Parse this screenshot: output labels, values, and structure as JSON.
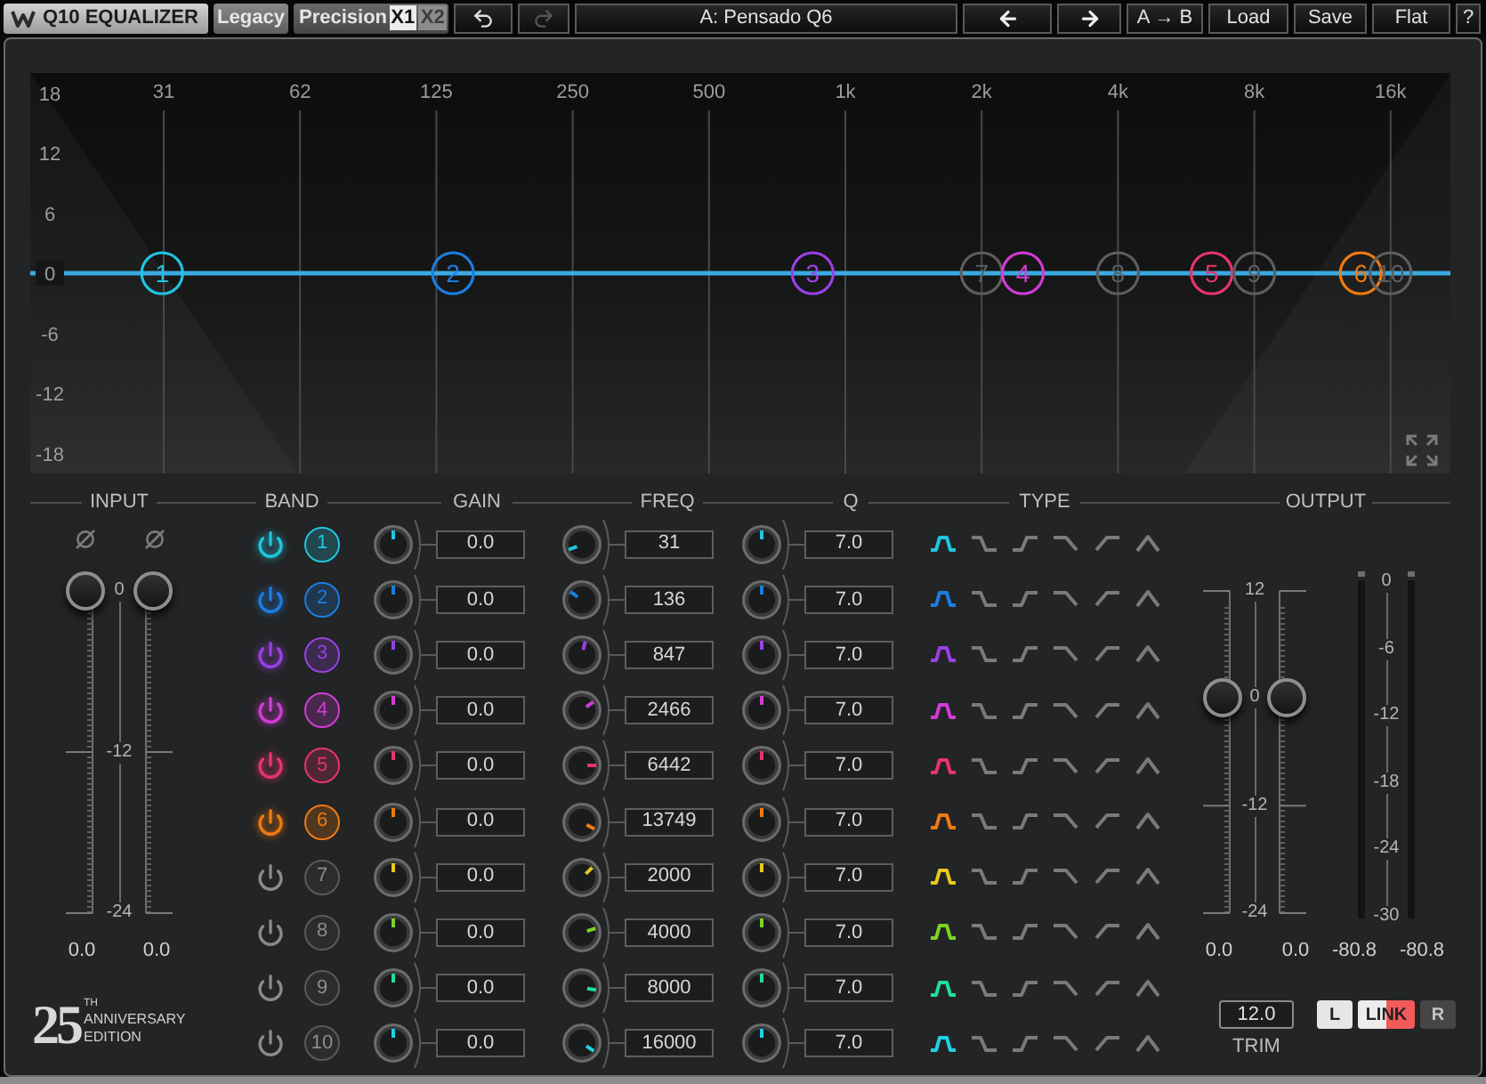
{
  "toolbar": {
    "logo": "Q10 EQUALIZER",
    "legacy": "Legacy",
    "precision": {
      "label": "Precision",
      "options": [
        {
          "label": "X1",
          "selected": true
        },
        {
          "label": "X2",
          "selected": false
        }
      ]
    },
    "history": [
      {
        "kind": "undo",
        "disabled": false
      },
      {
        "kind": "redo",
        "disabled": true
      }
    ],
    "preset": "A: Pensado Q6",
    "preset_nav": [
      {
        "kind": "prev"
      },
      {
        "kind": "next"
      }
    ],
    "buttons": [
      "A → B",
      "Load",
      "Save",
      "Flat",
      "?"
    ]
  },
  "graph": {
    "chart_data": {
      "type": "line",
      "categories": [
        null,
        "31",
        "62",
        "125",
        "250",
        "500",
        "1k",
        "2k",
        "4k",
        "8k",
        "16k"
      ],
      "values": [
        0,
        0,
        0,
        0,
        0,
        0,
        0,
        0,
        0,
        0,
        0
      ],
      "ylim": [
        -20,
        20
      ],
      "yticks": [
        18,
        12,
        6,
        0,
        -6,
        -12,
        -18
      ],
      "grid": true
    },
    "nodes": [
      "1",
      "2",
      "3",
      "7",
      "4",
      "8",
      "5",
      "9",
      "6",
      "10"
    ]
  },
  "input": {
    "title": "INPUT",
    "faders": [
      {
        "level": 1,
        "value": "0.0"
      },
      {
        "level": 1,
        "value": "0.0"
      }
    ],
    "scale": [
      "0",
      "-12",
      "-24"
    ]
  },
  "edition_badge": {
    "number": "25",
    "suffix": "TH",
    "lines": [
      "ANNIVERSARY",
      "EDITION"
    ]
  },
  "bands": {
    "columns": [
      "BAND",
      "GAIN",
      "FREQ",
      "Q",
      "TYPE"
    ],
    "rows": [
      {
        "number": "1",
        "on": true,
        "color": "#1ec6e0",
        "gain": "0.0",
        "freq": "31",
        "q": "7.0",
        "types": [
          {
            "kind": "bell",
            "selected": true
          },
          {
            "kind": "lowshelf",
            "selected": false
          },
          {
            "kind": "highshelf",
            "selected": false
          },
          {
            "kind": "highcut",
            "selected": false
          },
          {
            "kind": "lowcut",
            "selected": false
          },
          {
            "kind": "peak",
            "selected": false
          }
        ]
      },
      {
        "number": "2",
        "on": true,
        "color": "#1c7de2",
        "gain": "0.0",
        "freq": "136",
        "q": "7.0",
        "types": [
          {
            "kind": "bell",
            "selected": true
          },
          {
            "kind": "lowshelf",
            "selected": false
          },
          {
            "kind": "highshelf",
            "selected": false
          },
          {
            "kind": "highcut",
            "selected": false
          },
          {
            "kind": "lowcut",
            "selected": false
          },
          {
            "kind": "peak",
            "selected": false
          }
        ]
      },
      {
        "number": "3",
        "on": true,
        "color": "#9a40e6",
        "gain": "0.0",
        "freq": "847",
        "q": "7.0",
        "types": [
          {
            "kind": "bell",
            "selected": true
          },
          {
            "kind": "lowshelf",
            "selected": false
          },
          {
            "kind": "highshelf",
            "selected": false
          },
          {
            "kind": "highcut",
            "selected": false
          },
          {
            "kind": "lowcut",
            "selected": false
          },
          {
            "kind": "peak",
            "selected": false
          }
        ]
      },
      {
        "number": "4",
        "on": true,
        "color": "#d23cd6",
        "gain": "0.0",
        "freq": "2466",
        "q": "7.0",
        "types": [
          {
            "kind": "bell",
            "selected": true
          },
          {
            "kind": "lowshelf",
            "selected": false
          },
          {
            "kind": "highshelf",
            "selected": false
          },
          {
            "kind": "highcut",
            "selected": false
          },
          {
            "kind": "lowcut",
            "selected": false
          },
          {
            "kind": "peak",
            "selected": false
          }
        ]
      },
      {
        "number": "5",
        "on": true,
        "color": "#e8346c",
        "gain": "0.0",
        "freq": "6442",
        "q": "7.0",
        "types": [
          {
            "kind": "bell",
            "selected": true
          },
          {
            "kind": "lowshelf",
            "selected": false
          },
          {
            "kind": "highshelf",
            "selected": false
          },
          {
            "kind": "highcut",
            "selected": false
          },
          {
            "kind": "lowcut",
            "selected": false
          },
          {
            "kind": "peak",
            "selected": false
          }
        ]
      },
      {
        "number": "6",
        "on": true,
        "color": "#f07a12",
        "gain": "0.0",
        "freq": "13749",
        "q": "7.0",
        "types": [
          {
            "kind": "bell",
            "selected": true
          },
          {
            "kind": "lowshelf",
            "selected": false
          },
          {
            "kind": "highshelf",
            "selected": false
          },
          {
            "kind": "highcut",
            "selected": false
          },
          {
            "kind": "lowcut",
            "selected": false
          },
          {
            "kind": "peak",
            "selected": false
          }
        ]
      },
      {
        "number": "7",
        "on": false,
        "color": "#e8c81a",
        "gain": "0.0",
        "freq": "2000",
        "q": "7.0",
        "types": [
          {
            "kind": "bell",
            "selected": true
          },
          {
            "kind": "lowshelf",
            "selected": false
          },
          {
            "kind": "highshelf",
            "selected": false
          },
          {
            "kind": "highcut",
            "selected": false
          },
          {
            "kind": "lowcut",
            "selected": false
          },
          {
            "kind": "peak",
            "selected": false
          }
        ]
      },
      {
        "number": "8",
        "on": false,
        "color": "#7cd422",
        "gain": "0.0",
        "freq": "4000",
        "q": "7.0",
        "types": [
          {
            "kind": "bell",
            "selected": true
          },
          {
            "kind": "lowshelf",
            "selected": false
          },
          {
            "kind": "highshelf",
            "selected": false
          },
          {
            "kind": "highcut",
            "selected": false
          },
          {
            "kind": "lowcut",
            "selected": false
          },
          {
            "kind": "peak",
            "selected": false
          }
        ]
      },
      {
        "number": "9",
        "on": false,
        "color": "#1fe09a",
        "gain": "0.0",
        "freq": "8000",
        "q": "7.0",
        "types": [
          {
            "kind": "bell",
            "selected": true
          },
          {
            "kind": "lowshelf",
            "selected": false
          },
          {
            "kind": "highshelf",
            "selected": false
          },
          {
            "kind": "highcut",
            "selected": false
          },
          {
            "kind": "lowcut",
            "selected": false
          },
          {
            "kind": "peak",
            "selected": false
          }
        ]
      },
      {
        "number": "10",
        "on": false,
        "color": "#1ed2e6",
        "gain": "0.0",
        "freq": "16000",
        "q": "7.0",
        "types": [
          {
            "kind": "bell",
            "selected": true
          },
          {
            "kind": "lowshelf",
            "selected": false
          },
          {
            "kind": "highshelf",
            "selected": false
          },
          {
            "kind": "highcut",
            "selected": false
          },
          {
            "kind": "lowcut",
            "selected": false
          },
          {
            "kind": "peak",
            "selected": false
          }
        ]
      }
    ]
  },
  "output": {
    "title": "OUTPUT",
    "trim_faders": [
      {
        "level": 0.667,
        "value": "0.0"
      },
      {
        "level": 0.667,
        "value": "0.0"
      }
    ],
    "trim_scale": [
      "12",
      "0",
      "-12",
      "-24"
    ],
    "meters": [
      {
        "level": 0,
        "reading": "-80.8"
      },
      {
        "level": 0,
        "reading": "-80.8"
      }
    ],
    "meter_scale": [
      "0",
      "-6",
      "-12",
      "-18",
      "-24",
      "-30"
    ],
    "trim": {
      "value": "12.0",
      "label": "TRIM"
    },
    "channel_buttons": [
      {
        "label": "L",
        "kind": "channel",
        "selected": true
      },
      {
        "label": "LINK",
        "kind": "link",
        "selected": true
      },
      {
        "label": "R",
        "kind": "channel",
        "selected": false
      }
    ]
  }
}
